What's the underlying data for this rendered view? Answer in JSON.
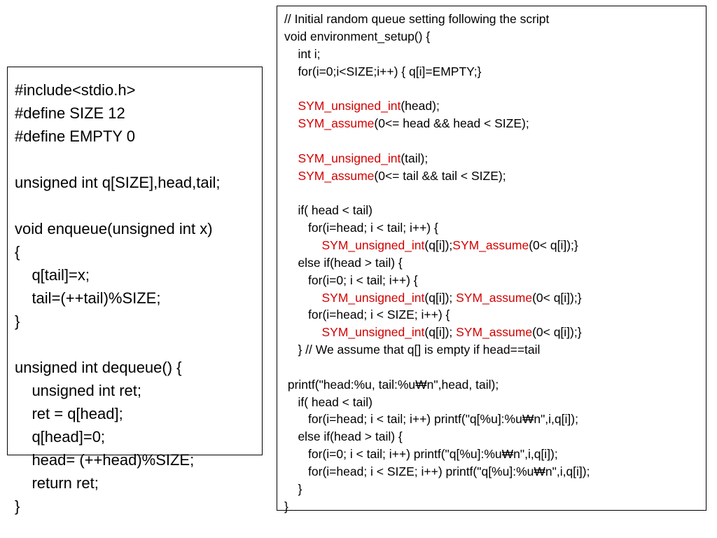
{
  "left_code": {
    "l1": "#include<stdio.h>",
    "l2": "#define SIZE 12",
    "l3": "#define EMPTY 0",
    "l4": "",
    "l5": "unsigned int q[SIZE],head,tail;",
    "l6": "",
    "l7": "void enqueue(unsigned int x)",
    "l8": "{",
    "l9": "    q[tail]=x;",
    "l10": "    tail=(++tail)%SIZE;",
    "l11": "}",
    "l12": "",
    "l13": "unsigned int dequeue() {",
    "l14": "    unsigned int ret;",
    "l15": "    ret = q[head];",
    "l16": "    q[head]=0;",
    "l17": "    head= (++head)%SIZE;",
    "l18": "    return ret;",
    "l19": "}"
  },
  "right_code": {
    "l1": "// Initial random queue setting following the script",
    "l2": "void environment_setup() {",
    "l3": "    int i;",
    "l4": "    for(i=0;i<SIZE;i++) { q[i]=EMPTY;}",
    "l5": "",
    "l6_a": "    ",
    "l6_b": "SYM_unsigned_int",
    "l6_c": "(head);",
    "l7_a": "    ",
    "l7_b": "SYM_assume",
    "l7_c": "(0<= head && head < SIZE);",
    "l8": "",
    "l9_a": "    ",
    "l9_b": "SYM_unsigned_int",
    "l9_c": "(tail);",
    "l10_a": "    ",
    "l10_b": "SYM_assume",
    "l10_c": "(0<= tail && tail < SIZE);",
    "l11": "",
    "l12": "    if( head < tail)",
    "l13": "       for(i=head; i < tail; i++) {",
    "l14_a": "           ",
    "l14_b": "SYM_unsigned_int",
    "l14_c": "(q[i]);",
    "l14_d": "SYM_assume",
    "l14_e": "(0< q[i]);}",
    "l15": "    else if(head > tail) {",
    "l16": "       for(i=0; i < tail; i++) {",
    "l17_a": "           ",
    "l17_b": "SYM_unsigned_int",
    "l17_c": "(q[i]); ",
    "l17_d": "SYM_assume",
    "l17_e": "(0< q[i]);}",
    "l18": "       for(i=head; i < SIZE; i++) {",
    "l19_a": "           ",
    "l19_b": "SYM_unsigned_int",
    "l19_c": "(q[i]); ",
    "l19_d": "SYM_assume",
    "l19_e": "(0< q[i]);}",
    "l20": "    } // We assume that q[] is empty if head==tail",
    "l21": "",
    "l22": " printf(\"head:%u, tail:%u₩n\",head, tail);",
    "l23": "    if( head < tail)",
    "l24": "       for(i=head; i < tail; i++) printf(\"q[%u]:%u₩n\",i,q[i]);",
    "l25": "    else if(head > tail) {",
    "l26": "       for(i=0; i < tail; i++) printf(\"q[%u]:%u₩n\",i,q[i]);",
    "l27": "       for(i=head; i < SIZE; i++) printf(\"q[%u]:%u₩n\",i,q[i]);",
    "l28": "    }",
    "l29": "}"
  }
}
